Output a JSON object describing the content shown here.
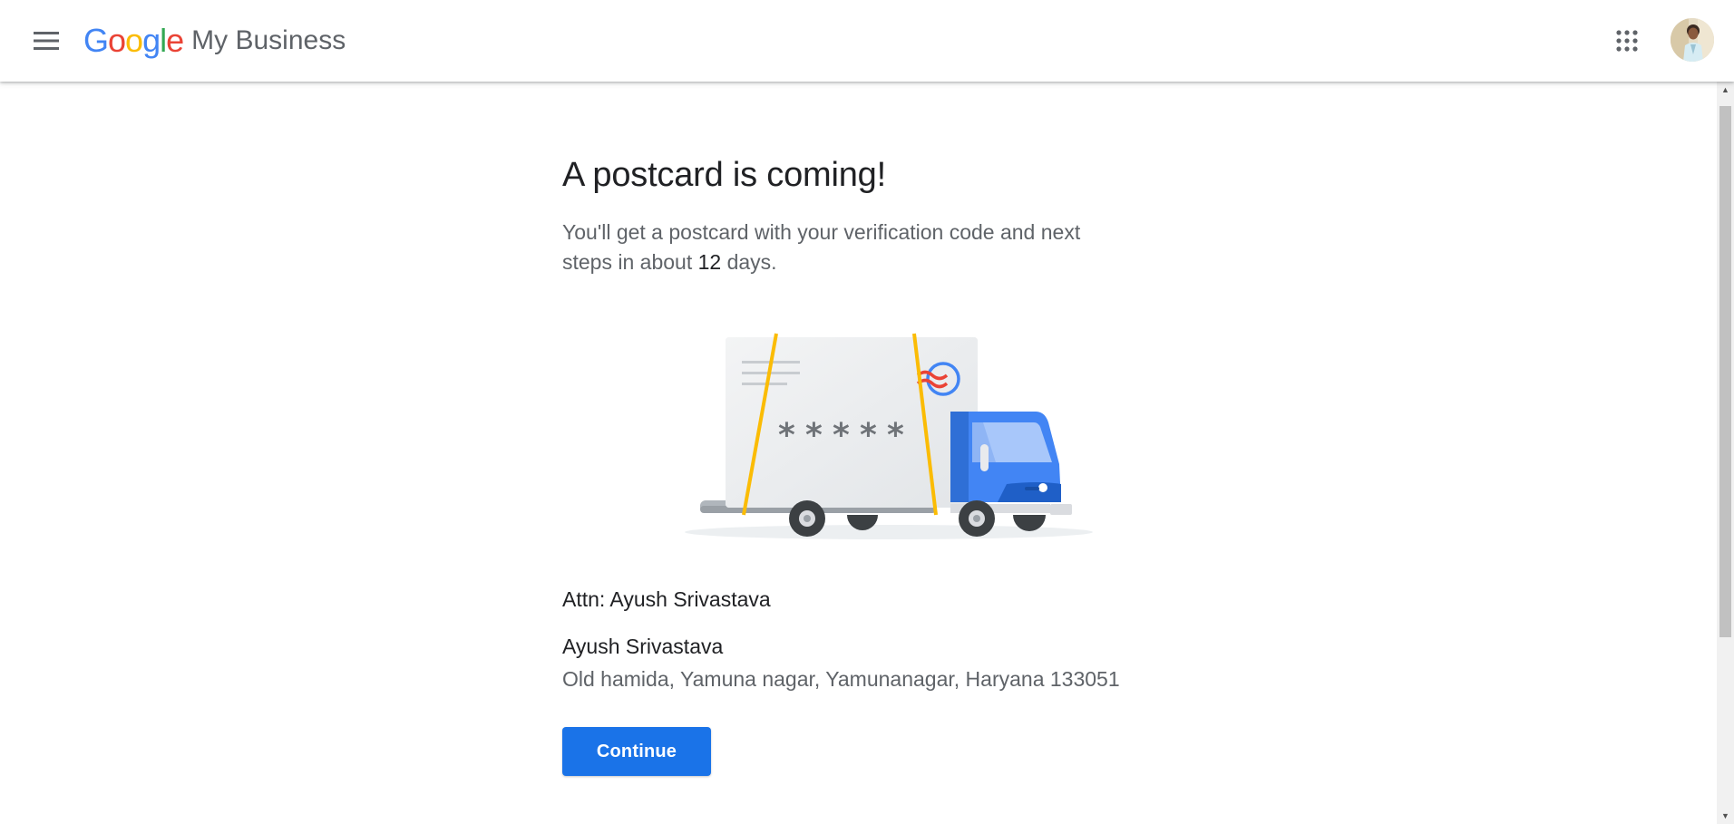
{
  "header": {
    "menu_icon": "hamburger-menu-icon",
    "brand_letters": [
      {
        "char": "G",
        "color": "#4285F4"
      },
      {
        "char": "o",
        "color": "#EA4335"
      },
      {
        "char": "o",
        "color": "#FBBC05"
      },
      {
        "char": "g",
        "color": "#4285F4"
      },
      {
        "char": "l",
        "color": "#34A853"
      },
      {
        "char": "e",
        "color": "#EA4335"
      }
    ],
    "brand_product": "My Business",
    "apps_icon": "apps-grid-icon",
    "avatar_icon": "account-avatar"
  },
  "main": {
    "headline": "A postcard is coming!",
    "subtitle_before": "You'll get a postcard with your verification code and next steps in about ",
    "subtitle_days": "12",
    "subtitle_after": " days.",
    "illustration": "postcard-delivery-truck-illustration",
    "postcard_code_mask": "*****",
    "attn_line": "Attn: Ayush Srivastava",
    "recipient_name": "Ayush Srivastava",
    "recipient_address": "Old hamida, Yamuna nagar, Yamunanagar, Haryana 133051",
    "continue_label": "Continue"
  },
  "colors": {
    "primary_button": "#1a73e8",
    "truck_blue": "#4285F4",
    "strap_yellow": "#FBBC05",
    "stamp_red": "#EA4335"
  }
}
